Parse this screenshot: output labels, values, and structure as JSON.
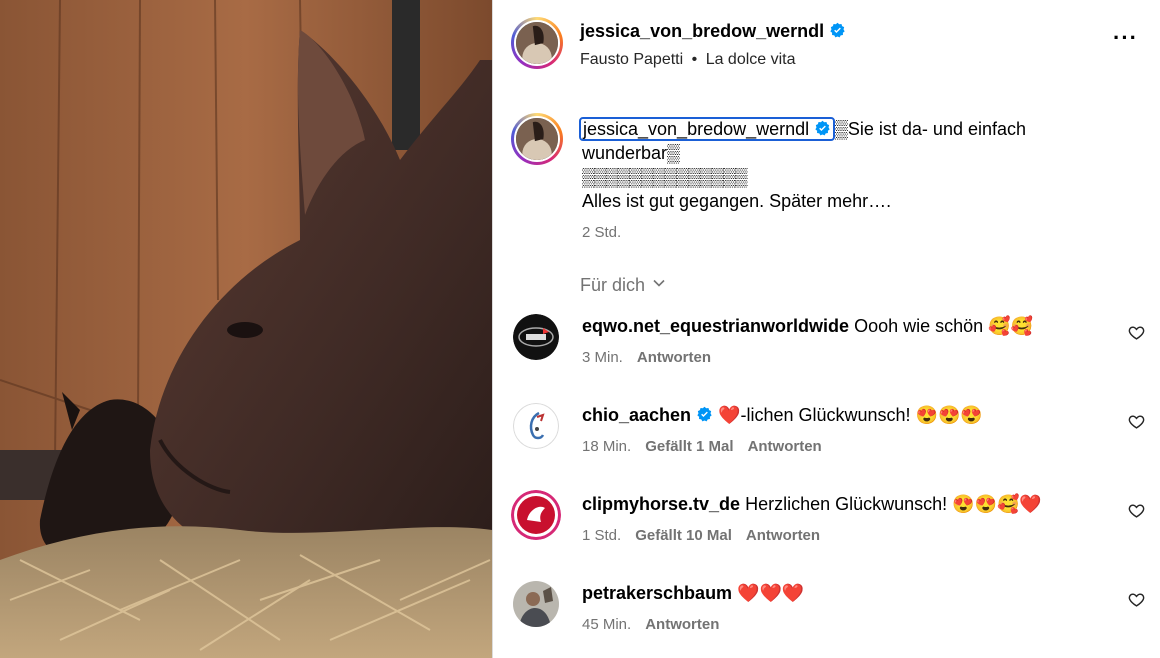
{
  "post": {
    "author": "jessica_von_bredow_werndl",
    "audio_artist": "Fausto Papetti",
    "audio_sep": "•",
    "audio_track": "La dolce vita",
    "more_icon": "more-horizontal-icon"
  },
  "caption": {
    "username": "jessica_von_bredow_werndl",
    "line1": "▒Sie ist da- und einfach",
    "line2": "wunderbar▒",
    "line3": "▒▒▒▒▒▒▒▒▒▒▒▒▒▒",
    "line4": "Alles ist gut gegangen. Später mehr….",
    "time": "2 Std."
  },
  "filter": {
    "label": "Für dich"
  },
  "comments": [
    {
      "user": "eqwo.net_equestrianworldwide",
      "verified": false,
      "text": "Oooh wie schön 🥰🥰",
      "time": "3 Min.",
      "likes": "",
      "reply": "Antworten"
    },
    {
      "user": "chio_aachen",
      "verified": true,
      "text": "❤️-lichen Glückwunsch! 😍😍😍",
      "time": "18 Min.",
      "likes": "Gefällt 1 Mal",
      "reply": "Antworten"
    },
    {
      "user": "clipmyhorse.tv_de",
      "verified": false,
      "text": "Herzlichen Glückwunsch! 😍😍🥰❤️",
      "time": "1 Std.",
      "likes": "Gefällt 10 Mal",
      "reply": "Antworten"
    },
    {
      "user": "petrakerschbaum",
      "verified": false,
      "text": "❤️❤️❤️",
      "time": "45 Min.",
      "likes": "",
      "reply": "Antworten"
    }
  ],
  "colors": {
    "verified": "#0095f6",
    "muted": "#737373",
    "focus": "#1a5fd6"
  }
}
